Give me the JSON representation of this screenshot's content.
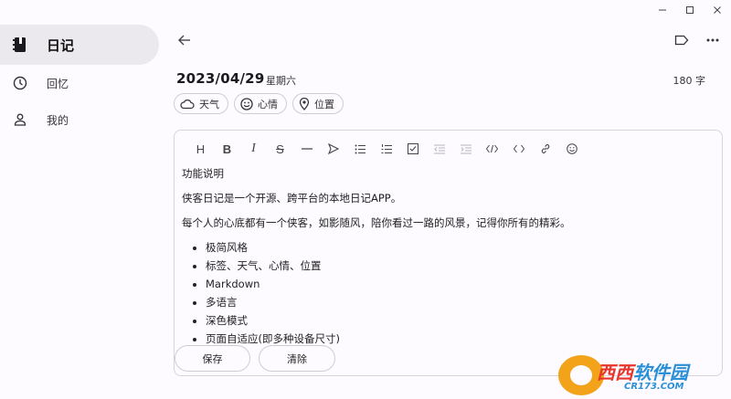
{
  "sidebar": {
    "items": [
      {
        "label": "日记",
        "icon": "diary-icon",
        "active": true
      },
      {
        "label": "回忆",
        "icon": "clock-icon",
        "active": false
      },
      {
        "label": "我的",
        "icon": "person-icon",
        "active": false
      }
    ]
  },
  "entry": {
    "date": "2023/04/29",
    "weekday": "星期六",
    "word_count": "180 字"
  },
  "chips": {
    "weather": "天气",
    "mood": "心情",
    "location": "位置"
  },
  "content": {
    "heading": "功能说明",
    "p1": "侠客日记是一个开源、跨平台的本地日记APP。",
    "p2": "每个人的心底都有一个侠客，如影随风，陪你看过一路的风景，记得你所有的精彩。",
    "features": [
      "极简风格",
      "标签、天气、心情、位置",
      "Markdown",
      "多语言",
      "深色模式",
      "页面自适应(即多种设备尺寸)"
    ]
  },
  "buttons": {
    "save": "保存",
    "clear": "清除"
  },
  "watermark": {
    "text_red": "西西",
    "text_blue": "软件园",
    "domain": "CR173.COM"
  },
  "colors": {
    "background": "#fdfbff",
    "active_nav": "#ebe9ee",
    "border": "#cfcdd3"
  }
}
